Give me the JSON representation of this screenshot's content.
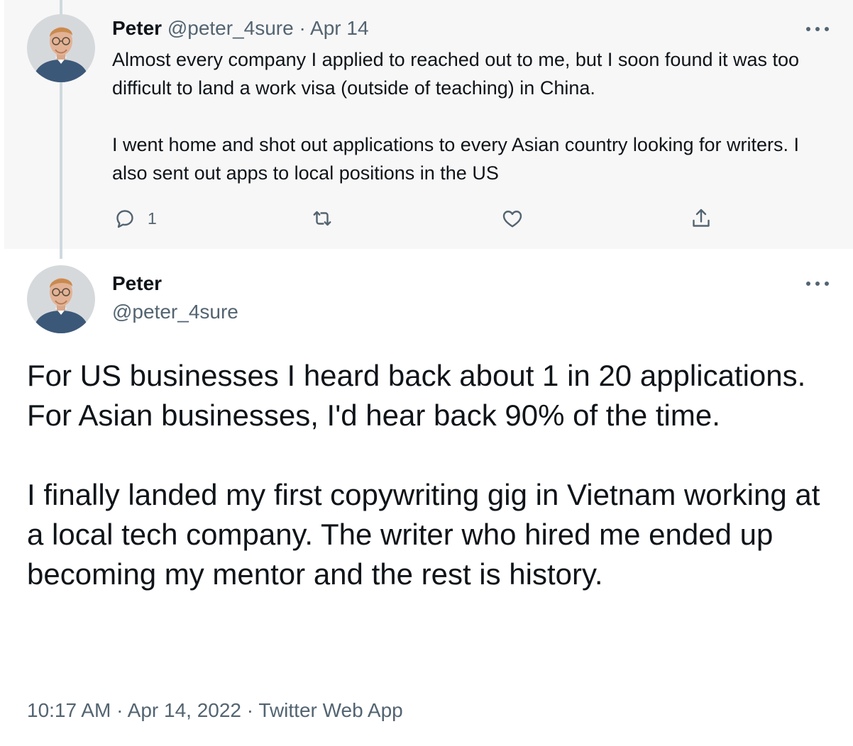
{
  "parent_tweet": {
    "author_name": "Peter",
    "handle": "@peter_4sure",
    "separator": "·",
    "date": "Apr 14",
    "paragraphs": [
      "Almost every company I applied to reached out to me, but I soon found it was too difficult to land a work visa (outside of teaching) in China.",
      "I went home and shot out applications to every Asian country looking for writers. I also sent out apps to local positions in the US"
    ],
    "actions": {
      "reply_icon": "reply-icon",
      "reply_count": "1",
      "retweet_icon": "retweet-icon",
      "like_icon": "heart-icon",
      "share_icon": "share-icon"
    },
    "more_icon": "more-icon"
  },
  "main_tweet": {
    "author_name": "Peter",
    "handle": "@peter_4sure",
    "paragraphs": [
      "For US businesses I heard back about 1 in 20 applications. For Asian businesses, I'd hear back 90% of the time.",
      "I finally landed my first copywriting gig in Vietnam working at a local tech company. The writer who hired me ended up becoming my mentor and the rest is history."
    ],
    "time": "10:17 AM",
    "separator": "·",
    "date": "Apr 14, 2022",
    "source": "Twitter Web App",
    "more_icon": "more-icon"
  },
  "colors": {
    "text_primary": "#0f1419",
    "text_secondary": "#536471",
    "parent_background": "#f7f7f7",
    "thread_line": "#cfd9de"
  }
}
